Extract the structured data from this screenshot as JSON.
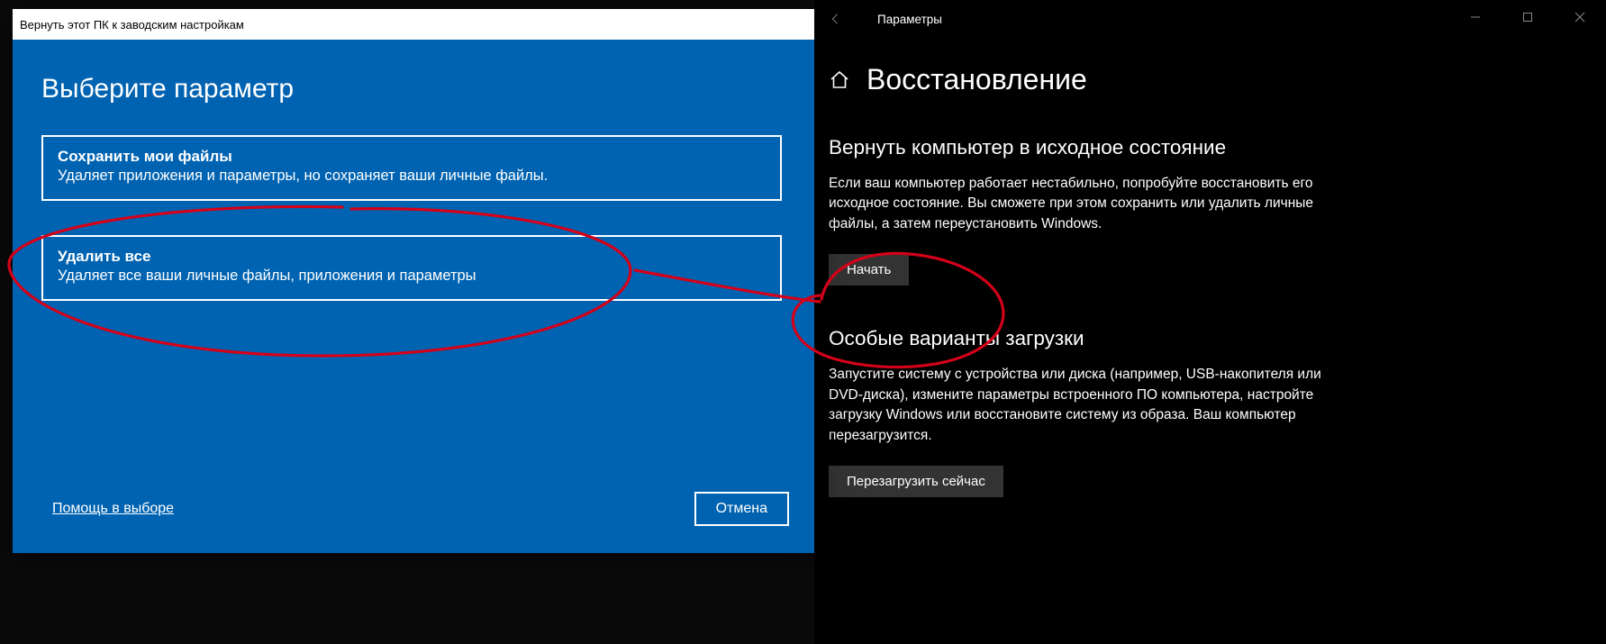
{
  "settingsWindow": {
    "titlebar": {
      "title": "Параметры"
    },
    "page": {
      "title": "Восстановление",
      "resetSection": {
        "heading": "Вернуть компьютер в исходное состояние",
        "text": "Если ваш компьютер работает нестабильно, попробуйте восстановить его исходное состояние. Вы сможете при этом сохранить или удалить личные файлы, а затем переустановить Windows.",
        "button": "Начать"
      },
      "advancedSection": {
        "heading": "Особые варианты загрузки",
        "text": "Запустите систему с устройства или диска (например, USB-накопителя или DVD-диска), измените параметры встроенного ПО компьютера, настройте загрузку Windows или восстановите систему из образа. Ваш компьютер перезагрузится.",
        "button": "Перезагрузить сейчас"
      }
    }
  },
  "resetDialog": {
    "title": "Вернуть этот ПК к заводским настройкам",
    "heading": "Выберите параметр",
    "options": [
      {
        "title": "Сохранить мои файлы",
        "desc": "Удаляет приложения и параметры, но сохраняет ваши личные файлы."
      },
      {
        "title": "Удалить все",
        "desc": "Удаляет все ваши личные файлы, приложения и параметры"
      }
    ],
    "helpLink": "Помощь в выборе",
    "cancel": "Отмена"
  }
}
